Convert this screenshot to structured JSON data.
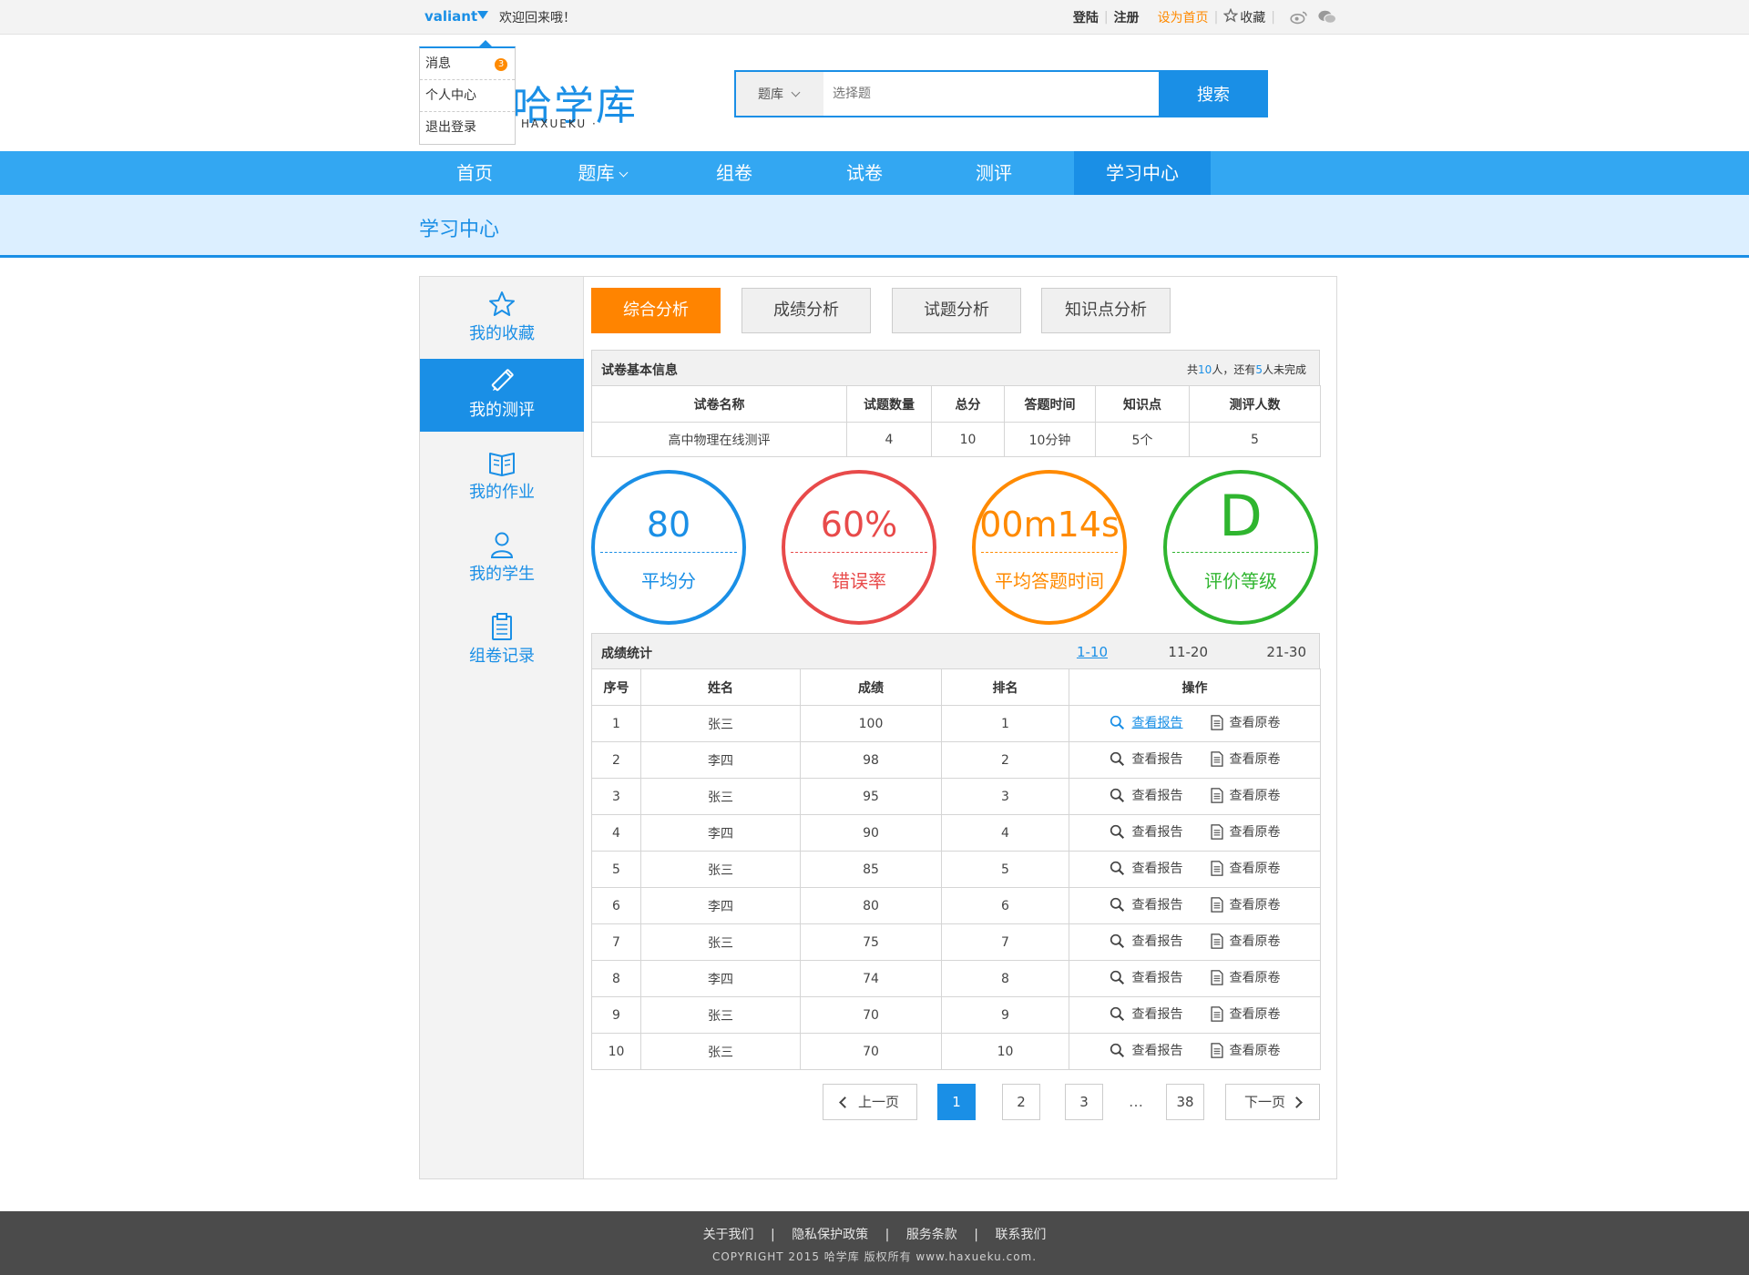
{
  "topbar": {
    "username": "valiant",
    "welcome": "欢迎回来哦！",
    "login": "登陆",
    "register": "注册",
    "set_home": "设为首页",
    "favorite": "收藏"
  },
  "user_menu": {
    "items": [
      {
        "label": "消息",
        "badge": "3"
      },
      {
        "label": "个人中心"
      },
      {
        "label": "退出登录"
      }
    ]
  },
  "header": {
    "logo_text": "哈学库",
    "logo_sub": "HAXUEKU ·",
    "search_category": "题库",
    "search_placeholder": "选择题",
    "search_button": "搜索"
  },
  "nav": {
    "items": [
      "首页",
      "题库",
      "组卷",
      "试卷",
      "测评",
      "学习中心"
    ],
    "active": "学习中心"
  },
  "page_title": "学习中心",
  "sidebar": {
    "items": [
      {
        "label": "我的收藏",
        "icon": "star-icon"
      },
      {
        "label": "我的测评",
        "icon": "pencil-icon"
      },
      {
        "label": "我的作业",
        "icon": "book-icon"
      },
      {
        "label": "我的学生",
        "icon": "user-icon"
      },
      {
        "label": "组卷记录",
        "icon": "clipboard-icon"
      }
    ],
    "active": "我的测评"
  },
  "tabs": [
    "综合分析",
    "成绩分析",
    "试题分析",
    "知识点分析"
  ],
  "basic_info": {
    "title": "试卷基本信息",
    "meta_prefix": "共",
    "total": "10",
    "meta_mid": "人，还有",
    "unfinished": "5",
    "meta_suffix": "人未完成",
    "headers": [
      "试卷名称",
      "试题数量",
      "总分",
      "答题时间",
      "知识点",
      "测评人数"
    ],
    "row": [
      "高中物理在线测评",
      "4",
      "10",
      "10分钟",
      "5个",
      "5"
    ]
  },
  "metrics": [
    {
      "value": "80",
      "label": "平均分",
      "color": "#1a8fe6"
    },
    {
      "value": "60%",
      "label": "错误率",
      "color": "#e84a4a"
    },
    {
      "value": "00m14s",
      "label": "平均答题时间",
      "color": "#ff8a00"
    },
    {
      "value": "D",
      "label": "评价等级",
      "color": "#2fb52f"
    }
  ],
  "scores": {
    "title": "成绩统计",
    "ranges": [
      "1-10",
      "11-20",
      "21-30"
    ],
    "active_range": "1-10",
    "headers": [
      "序号",
      "姓名",
      "成绩",
      "排名",
      "操作"
    ],
    "report_label": "查看报告",
    "original_label": "查看原卷",
    "rows": [
      [
        "1",
        "张三",
        "100",
        "1"
      ],
      [
        "2",
        "李四",
        "98",
        "2"
      ],
      [
        "3",
        "张三",
        "95",
        "3"
      ],
      [
        "4",
        "李四",
        "90",
        "4"
      ],
      [
        "5",
        "张三",
        "85",
        "5"
      ],
      [
        "6",
        "李四",
        "80",
        "6"
      ],
      [
        "7",
        "张三",
        "75",
        "7"
      ],
      [
        "8",
        "李四",
        "74",
        "8"
      ],
      [
        "9",
        "张三",
        "70",
        "9"
      ],
      [
        "10",
        "张三",
        "70",
        "10"
      ]
    ]
  },
  "pagination": {
    "prev": "上一页",
    "pages": [
      "1",
      "2",
      "3"
    ],
    "dots": "…",
    "last": "38",
    "next": "下一页",
    "current": "1"
  },
  "footer": {
    "links": [
      "关于我们",
      "隐私保护政策",
      "服务条款",
      "联系我们"
    ],
    "separator": "|",
    "copyright": "COPYRIGHT 2015  哈学库  版权所有   www.haxueku.com."
  }
}
